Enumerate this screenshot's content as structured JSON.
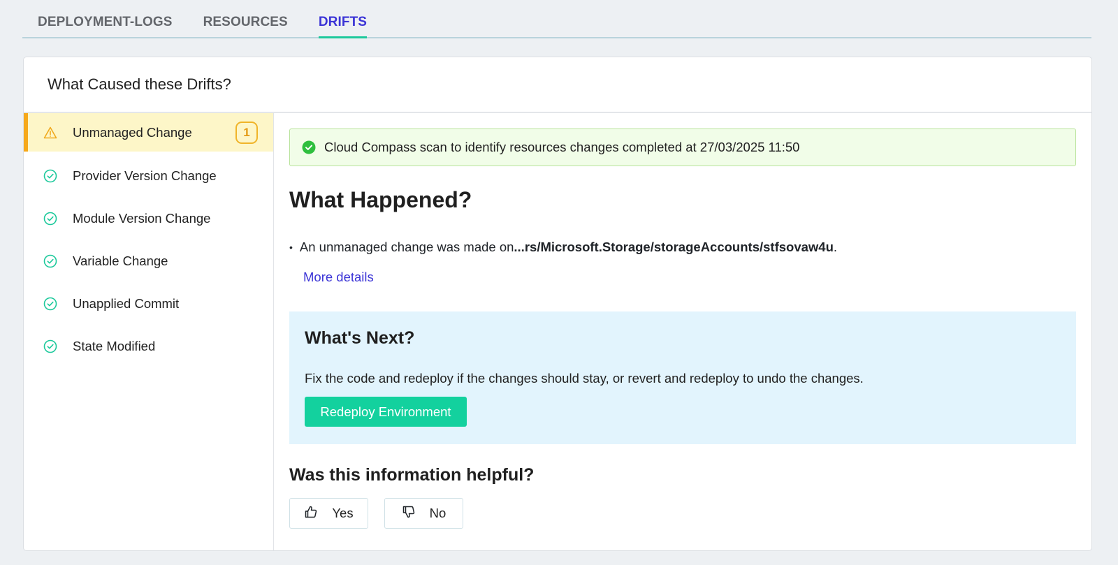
{
  "tabs": [
    {
      "label": "DEPLOYMENT-LOGS",
      "active": false
    },
    {
      "label": "RESOURCES",
      "active": false
    },
    {
      "label": "DRIFTS",
      "active": true
    }
  ],
  "card": {
    "title": "What Caused these Drifts?"
  },
  "sidebar": {
    "items": [
      {
        "label": "Unmanaged Change",
        "icon": "warning-icon",
        "badge": "1",
        "active": true
      },
      {
        "label": "Provider Version Change",
        "icon": "check-circle-icon"
      },
      {
        "label": "Module Version Change",
        "icon": "check-circle-icon"
      },
      {
        "label": "Variable Change",
        "icon": "check-circle-icon"
      },
      {
        "label": "Unapplied Commit",
        "icon": "check-circle-icon"
      },
      {
        "label": "State Modified",
        "icon": "check-circle-icon"
      }
    ]
  },
  "main": {
    "scan_message": "Cloud Compass scan to identify resources changes completed at 27/03/2025 11:50",
    "what_happened_title": "What Happened?",
    "change_prefix": "An unmanaged change was made on ",
    "change_path": "...rs/Microsoft.Storage/storageAccounts/stfsovaw4u",
    "change_suffix": ".",
    "more_details": "More details",
    "whats_next_title": "What's Next?",
    "whats_next_text": "Fix the code and redeploy if the changes should stay, or revert and redeploy to undo the changes.",
    "redeploy_label": "Redeploy Environment",
    "helpful_title": "Was this information helpful?",
    "yes_label": "Yes",
    "no_label": "No"
  },
  "colors": {
    "accent": "#3b34d6",
    "success": "#1cc99b",
    "warning": "#f6a81a"
  }
}
